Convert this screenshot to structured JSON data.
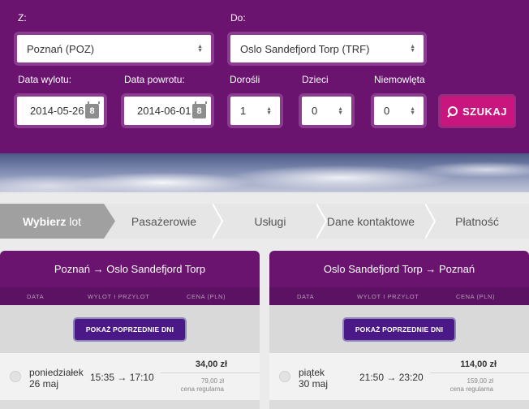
{
  "search": {
    "from_label": "Z:",
    "from_value": "Poznań (POZ)",
    "to_label": "Do:",
    "to_value": "Oslo Sandefjord Torp (TRF)",
    "depart_label": "Data wylotu:",
    "depart_value": "2014-05-26",
    "return_label": "Data powrotu:",
    "return_value": "2014-06-01",
    "adults_label": "Dorośli",
    "adults_value": "1",
    "children_label": "Dzieci",
    "children_value": "0",
    "infants_label": "Niemowlęta",
    "infants_value": "0",
    "search_button": "SZUKAJ",
    "calendar_glyph": "8"
  },
  "steps": [
    {
      "label": "Wybierz lot",
      "bold": "Wybierz",
      "rest": " lot",
      "active": true
    },
    {
      "label": "Pasażerowie"
    },
    {
      "label": "Usługi"
    },
    {
      "label": "Dane kontaktowe"
    },
    {
      "label": "Płatność"
    }
  ],
  "columns": {
    "date": "DATA",
    "times": "WYLOT I PRZYLOT",
    "price": "CENA (PLN)"
  },
  "outbound": {
    "title": "Poznań → Oslo Sandefjord Torp",
    "prev_button": "POKAŻ POPRZEDNIE DNI",
    "weekday": "poniedziałek",
    "date": "26 maj",
    "times": "15:35 → 17:10",
    "price": "34,00 zł",
    "regular_price": "79,00 zł",
    "regular_label": "cena regularna"
  },
  "inbound": {
    "title": "Oslo Sandefjord Torp → Poznań",
    "prev_button": "POKAŻ POPRZEDNIE DNI",
    "weekday": "piątek",
    "date": "30 maj",
    "times": "21:50 → 23:20",
    "price": "114,00 zł",
    "regular_price": "159,00 zł",
    "regular_label": "cena regularna"
  },
  "colors": {
    "brand_purple": "#6a1470",
    "accent_pink": "#c8167e",
    "button_violet": "#4a1887"
  }
}
